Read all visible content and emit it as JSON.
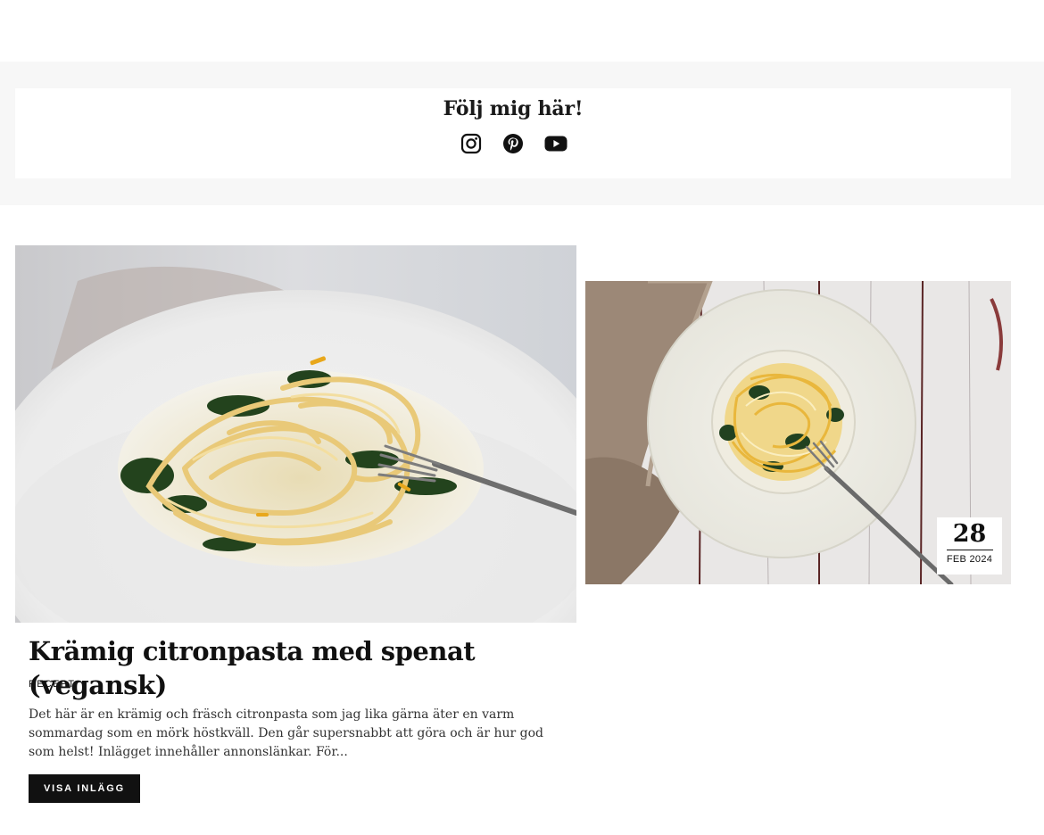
{
  "follow": {
    "title": "Följ mig här!",
    "links": [
      {
        "name": "instagram-icon"
      },
      {
        "name": "pinterest-icon"
      },
      {
        "name": "youtube-icon"
      }
    ]
  },
  "posts": [
    {
      "title": "Krämig citronpasta med spenat (vegansk)",
      "category": "RECEPT",
      "excerpt": "Det här är en krämig och fräsch citronpasta som jag lika gärna äter en varm sommardag som en mörk höstkväll. Den går supersnabbt att göra och är hur god som helst! Inlägget innehåller annonslänkar. För...",
      "button_label": "VISA INLÄGG",
      "image": "lemon-pasta-spinach-photo"
    },
    {
      "date_day": "28",
      "date_month": "FEB 2024",
      "image": "lemon-pasta-overhead-photo"
    }
  ],
  "colors": {
    "band_bg": "#f7f7f7",
    "button_bg": "#111111",
    "text": "#111111"
  }
}
